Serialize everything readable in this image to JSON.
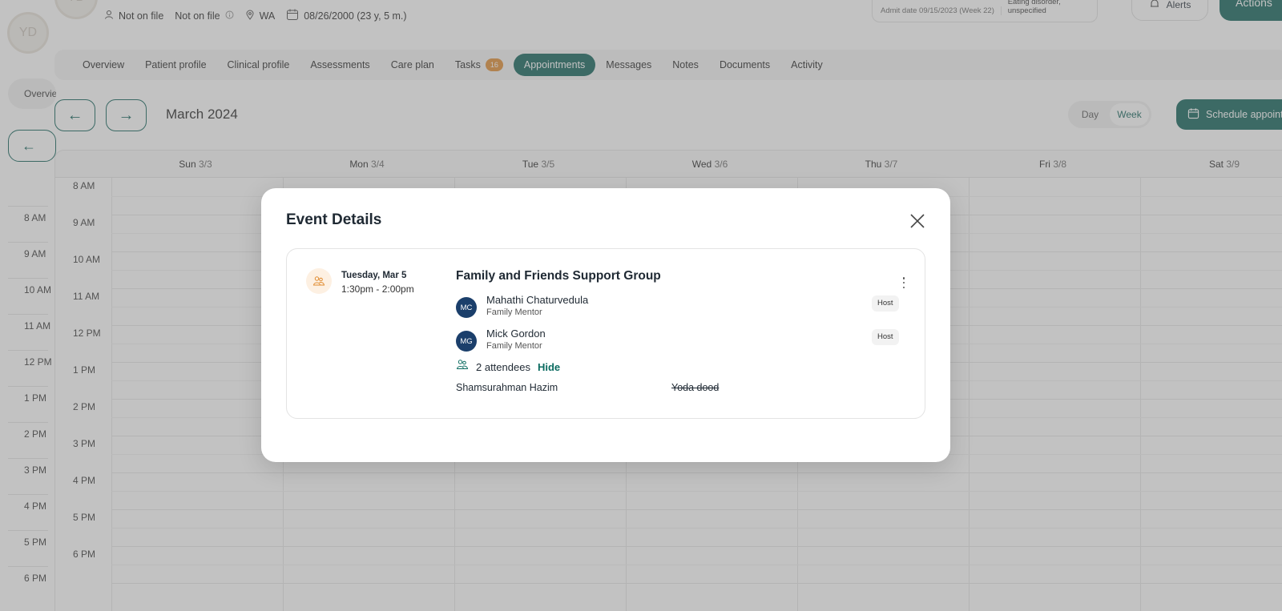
{
  "patient": {
    "initials": "YD",
    "fields": [
      "Not on file",
      "Not on file",
      "WA",
      "08/26/2000 (23 y, 5 m.)"
    ],
    "admit": "Admit date 09/15/2023 (Week 22)",
    "diagnosis": "Eating disorder, unspecified"
  },
  "header": {
    "alerts_label": "Alerts",
    "actions_label": "Actions"
  },
  "sidebar": {
    "initials": "YD",
    "pill_label": "Overview",
    "times": [
      "8 AM",
      "9 AM",
      "10 AM",
      "11 AM",
      "12 PM",
      "1 PM",
      "2 PM",
      "3 PM",
      "4 PM",
      "5 PM",
      "6 PM"
    ]
  },
  "tabs": [
    {
      "label": "Overview"
    },
    {
      "label": "Patient profile"
    },
    {
      "label": "Clinical profile"
    },
    {
      "label": "Assessments"
    },
    {
      "label": "Care plan"
    },
    {
      "label": "Tasks",
      "badge": "16"
    },
    {
      "label": "Appointments",
      "active": true
    },
    {
      "label": "Messages"
    },
    {
      "label": "Notes"
    },
    {
      "label": "Documents"
    },
    {
      "label": "Activity"
    }
  ],
  "calendar": {
    "month": "March 2024",
    "view_day": "Day",
    "view_week": "Week",
    "schedule_label": "Schedule appointment",
    "days": [
      {
        "name": "Sun",
        "date": "3/3"
      },
      {
        "name": "Mon",
        "date": "3/4"
      },
      {
        "name": "Tue",
        "date": "3/5"
      },
      {
        "name": "Wed",
        "date": "3/6"
      },
      {
        "name": "Thu",
        "date": "3/7"
      },
      {
        "name": "Fri",
        "date": "3/8"
      },
      {
        "name": "Sat",
        "date": "3/9"
      }
    ],
    "times": [
      "8 AM",
      "9 AM",
      "10 AM",
      "11 AM",
      "12 PM",
      "1 PM",
      "2 PM",
      "3 PM",
      "4 PM",
      "5 PM",
      "6 PM"
    ]
  },
  "modal": {
    "title": "Event Details",
    "event": {
      "date": "Tuesday, Mar 5",
      "time": "1:30pm - 2:00pm",
      "title": "Family and Friends Support Group",
      "hosts": [
        {
          "initials": "MC",
          "name": "Mahathi Chaturvedula",
          "role": "Family Mentor",
          "tag": "Host"
        },
        {
          "initials": "MG",
          "name": "Mick Gordon",
          "role": "Family Mentor",
          "tag": "Host"
        }
      ],
      "attendee_count": "2 attendees",
      "hide_label": "Hide",
      "attendees": [
        {
          "name": "Shamsurahman Hazim",
          "struck": false
        },
        {
          "name": "Yoda dood",
          "struck": true
        }
      ]
    }
  },
  "colors": {
    "accent": "#0b5f56",
    "badge": "#e08a2e",
    "avatar": "#1b3f6b",
    "overlay": "rgba(120,120,120,0.45)"
  }
}
